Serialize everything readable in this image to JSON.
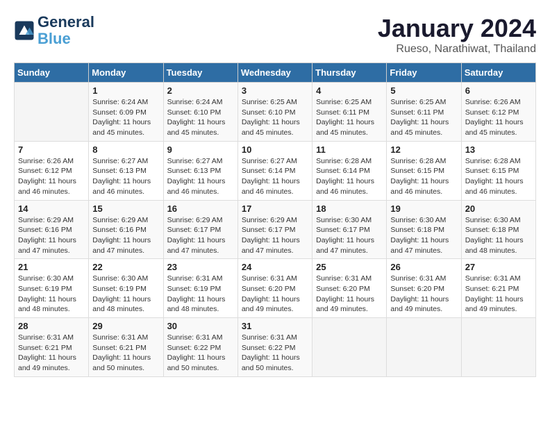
{
  "header": {
    "logo_line1": "General",
    "logo_line2": "Blue",
    "calendar_title": "January 2024",
    "calendar_subtitle": "Rueso, Narathiwat, Thailand"
  },
  "weekdays": [
    "Sunday",
    "Monday",
    "Tuesday",
    "Wednesday",
    "Thursday",
    "Friday",
    "Saturday"
  ],
  "weeks": [
    [
      {
        "day": "",
        "info": ""
      },
      {
        "day": "1",
        "info": "Sunrise: 6:24 AM\nSunset: 6:09 PM\nDaylight: 11 hours\nand 45 minutes."
      },
      {
        "day": "2",
        "info": "Sunrise: 6:24 AM\nSunset: 6:10 PM\nDaylight: 11 hours\nand 45 minutes."
      },
      {
        "day": "3",
        "info": "Sunrise: 6:25 AM\nSunset: 6:10 PM\nDaylight: 11 hours\nand 45 minutes."
      },
      {
        "day": "4",
        "info": "Sunrise: 6:25 AM\nSunset: 6:11 PM\nDaylight: 11 hours\nand 45 minutes."
      },
      {
        "day": "5",
        "info": "Sunrise: 6:25 AM\nSunset: 6:11 PM\nDaylight: 11 hours\nand 45 minutes."
      },
      {
        "day": "6",
        "info": "Sunrise: 6:26 AM\nSunset: 6:12 PM\nDaylight: 11 hours\nand 45 minutes."
      }
    ],
    [
      {
        "day": "7",
        "info": "Sunrise: 6:26 AM\nSunset: 6:12 PM\nDaylight: 11 hours\nand 46 minutes."
      },
      {
        "day": "8",
        "info": "Sunrise: 6:27 AM\nSunset: 6:13 PM\nDaylight: 11 hours\nand 46 minutes."
      },
      {
        "day": "9",
        "info": "Sunrise: 6:27 AM\nSunset: 6:13 PM\nDaylight: 11 hours\nand 46 minutes."
      },
      {
        "day": "10",
        "info": "Sunrise: 6:27 AM\nSunset: 6:14 PM\nDaylight: 11 hours\nand 46 minutes."
      },
      {
        "day": "11",
        "info": "Sunrise: 6:28 AM\nSunset: 6:14 PM\nDaylight: 11 hours\nand 46 minutes."
      },
      {
        "day": "12",
        "info": "Sunrise: 6:28 AM\nSunset: 6:15 PM\nDaylight: 11 hours\nand 46 minutes."
      },
      {
        "day": "13",
        "info": "Sunrise: 6:28 AM\nSunset: 6:15 PM\nDaylight: 11 hours\nand 46 minutes."
      }
    ],
    [
      {
        "day": "14",
        "info": "Sunrise: 6:29 AM\nSunset: 6:16 PM\nDaylight: 11 hours\nand 47 minutes."
      },
      {
        "day": "15",
        "info": "Sunrise: 6:29 AM\nSunset: 6:16 PM\nDaylight: 11 hours\nand 47 minutes."
      },
      {
        "day": "16",
        "info": "Sunrise: 6:29 AM\nSunset: 6:17 PM\nDaylight: 11 hours\nand 47 minutes."
      },
      {
        "day": "17",
        "info": "Sunrise: 6:29 AM\nSunset: 6:17 PM\nDaylight: 11 hours\nand 47 minutes."
      },
      {
        "day": "18",
        "info": "Sunrise: 6:30 AM\nSunset: 6:17 PM\nDaylight: 11 hours\nand 47 minutes."
      },
      {
        "day": "19",
        "info": "Sunrise: 6:30 AM\nSunset: 6:18 PM\nDaylight: 11 hours\nand 47 minutes."
      },
      {
        "day": "20",
        "info": "Sunrise: 6:30 AM\nSunset: 6:18 PM\nDaylight: 11 hours\nand 48 minutes."
      }
    ],
    [
      {
        "day": "21",
        "info": "Sunrise: 6:30 AM\nSunset: 6:19 PM\nDaylight: 11 hours\nand 48 minutes."
      },
      {
        "day": "22",
        "info": "Sunrise: 6:30 AM\nSunset: 6:19 PM\nDaylight: 11 hours\nand 48 minutes."
      },
      {
        "day": "23",
        "info": "Sunrise: 6:31 AM\nSunset: 6:19 PM\nDaylight: 11 hours\nand 48 minutes."
      },
      {
        "day": "24",
        "info": "Sunrise: 6:31 AM\nSunset: 6:20 PM\nDaylight: 11 hours\nand 49 minutes."
      },
      {
        "day": "25",
        "info": "Sunrise: 6:31 AM\nSunset: 6:20 PM\nDaylight: 11 hours\nand 49 minutes."
      },
      {
        "day": "26",
        "info": "Sunrise: 6:31 AM\nSunset: 6:20 PM\nDaylight: 11 hours\nand 49 minutes."
      },
      {
        "day": "27",
        "info": "Sunrise: 6:31 AM\nSunset: 6:21 PM\nDaylight: 11 hours\nand 49 minutes."
      }
    ],
    [
      {
        "day": "28",
        "info": "Sunrise: 6:31 AM\nSunset: 6:21 PM\nDaylight: 11 hours\nand 49 minutes."
      },
      {
        "day": "29",
        "info": "Sunrise: 6:31 AM\nSunset: 6:21 PM\nDaylight: 11 hours\nand 50 minutes."
      },
      {
        "day": "30",
        "info": "Sunrise: 6:31 AM\nSunset: 6:22 PM\nDaylight: 11 hours\nand 50 minutes."
      },
      {
        "day": "31",
        "info": "Sunrise: 6:31 AM\nSunset: 6:22 PM\nDaylight: 11 hours\nand 50 minutes."
      },
      {
        "day": "",
        "info": ""
      },
      {
        "day": "",
        "info": ""
      },
      {
        "day": "",
        "info": ""
      }
    ]
  ]
}
